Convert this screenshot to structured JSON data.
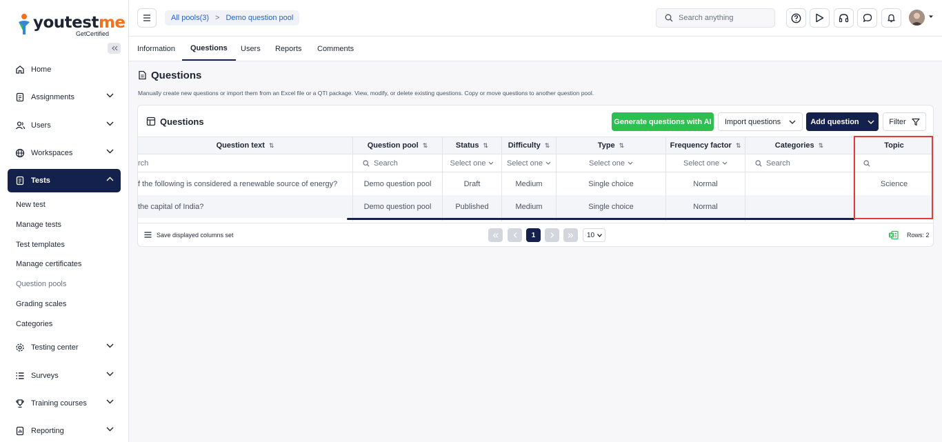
{
  "brand": {
    "name_a": "youtest",
    "name_b": "me",
    "tagline": "GetCertified"
  },
  "sidebar": {
    "items": [
      {
        "label": "Home",
        "icon": "home-icon"
      },
      {
        "label": "Assignments",
        "icon": "document-icon"
      },
      {
        "label": "Users",
        "icon": "users-icon"
      },
      {
        "label": "Workspaces",
        "icon": "globe-icon"
      },
      {
        "label": "Tests",
        "icon": "test-icon"
      },
      {
        "label": "Testing center",
        "icon": "gear-icon"
      },
      {
        "label": "Surveys",
        "icon": "list-icon"
      },
      {
        "label": "Training courses",
        "icon": "trophy-icon"
      },
      {
        "label": "Reporting",
        "icon": "reporting-icon"
      }
    ],
    "tests_sub": [
      "New test",
      "Manage tests",
      "Test templates",
      "Manage certificates",
      "Question pools",
      "Grading scales",
      "Categories"
    ]
  },
  "topbar": {
    "breadcrumb_root": "All pools(3)",
    "breadcrumb_sep": ">",
    "breadcrumb_current": "Demo question pool",
    "search_placeholder": "Search anything"
  },
  "tabs": [
    "Information",
    "Questions",
    "Users",
    "Reports",
    "Comments"
  ],
  "page": {
    "title": "Questions",
    "description": "Manually create new questions or import them from an Excel file or a QTI package. View, modify, or delete existing questions. Copy or move questions to another question pool."
  },
  "panel": {
    "title": "Questions",
    "generate_label": "Generate questions with AI",
    "import_label": "Import questions",
    "add_label": "Add question",
    "filter_label": "Filter"
  },
  "table": {
    "columns": [
      "Question text",
      "Question pool",
      "Status",
      "Difficulty",
      "Type",
      "Frequency factor",
      "Categories",
      "Topic"
    ],
    "filters": {
      "question_text": "rch",
      "question_pool": "Search",
      "status": "Select one",
      "difficulty": "Select one",
      "type": "Select one",
      "frequency": "Select one",
      "categories": "Search"
    },
    "rows": [
      {
        "question_text": "f the following is considered a renewable source of energy?",
        "question_pool": "Demo question pool",
        "status": "Draft",
        "difficulty": "Medium",
        "type": "Single choice",
        "frequency": "Normal",
        "categories": "",
        "topic": "Science"
      },
      {
        "question_text": "the capital of India?",
        "question_pool": "Demo question pool",
        "status": "Published",
        "difficulty": "Medium",
        "type": "Single choice",
        "frequency": "Normal",
        "categories": "",
        "topic": ""
      }
    ]
  },
  "footer": {
    "save_columns_label": "Save displayed columns set",
    "current_page": "1",
    "page_size": "10",
    "rows_label": "Rows: 2"
  },
  "colors": {
    "accent_dark": "#14214c",
    "green": "#2bc04f",
    "highlight": "#e03b3b",
    "link": "#2563c9"
  }
}
